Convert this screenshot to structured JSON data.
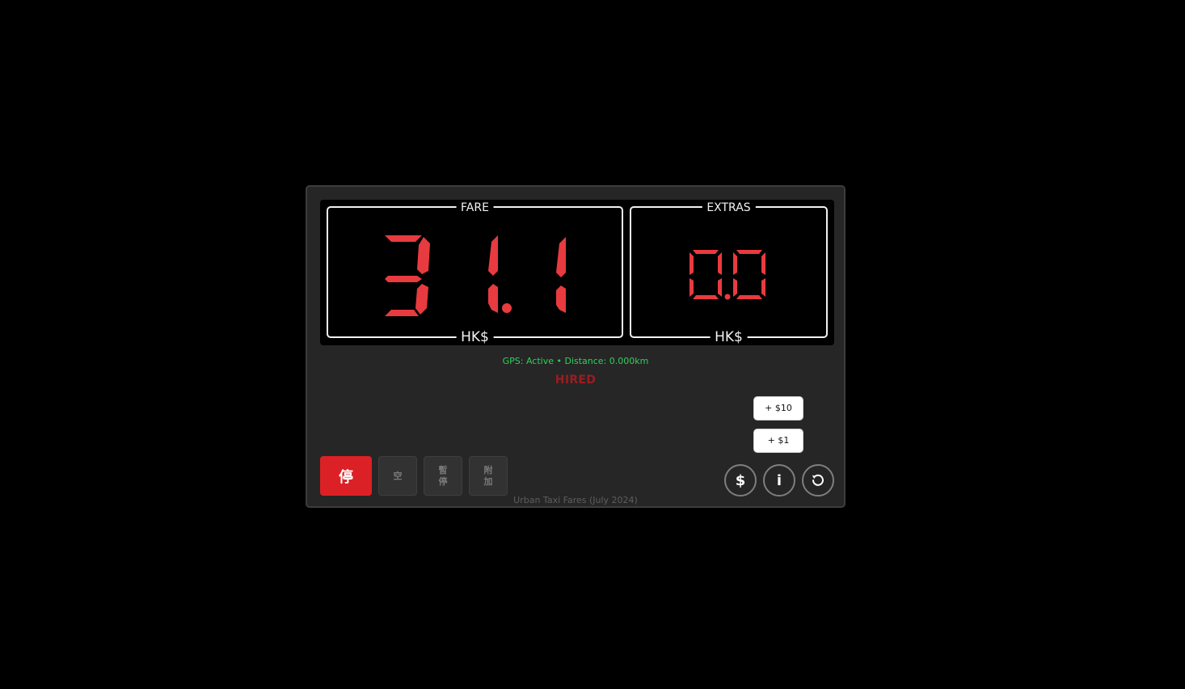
{
  "fare": {
    "label": "FARE",
    "value": "31.1",
    "currency": "HK$"
  },
  "extras": {
    "label": "EXTRAS",
    "value": "0.0",
    "currency": "HK$"
  },
  "gps_status": "GPS: Active • Distance: 0.000km",
  "meter_status": "HIRED",
  "addons": {
    "plus_ten_label": "+ $10",
    "plus_one_label": "+ $1"
  },
  "mode_buttons": {
    "stop_label": "停",
    "vacant_label": "空",
    "pause_line1": "暫",
    "pause_line2": "停",
    "extra_line1": "附",
    "extra_line2": "加"
  },
  "round_buttons": {
    "dollar_label": "$",
    "info_label": "i",
    "reset_icon": "reset-icon"
  },
  "footer_text": "Urban Taxi Fares (July 2024)",
  "colors": {
    "digit": "#e83b3f",
    "gps_text": "#2ed158",
    "status_hired": "#9a1d21",
    "stop_button": "#db2125",
    "background": "#000000",
    "panel_bg": "#262626"
  }
}
